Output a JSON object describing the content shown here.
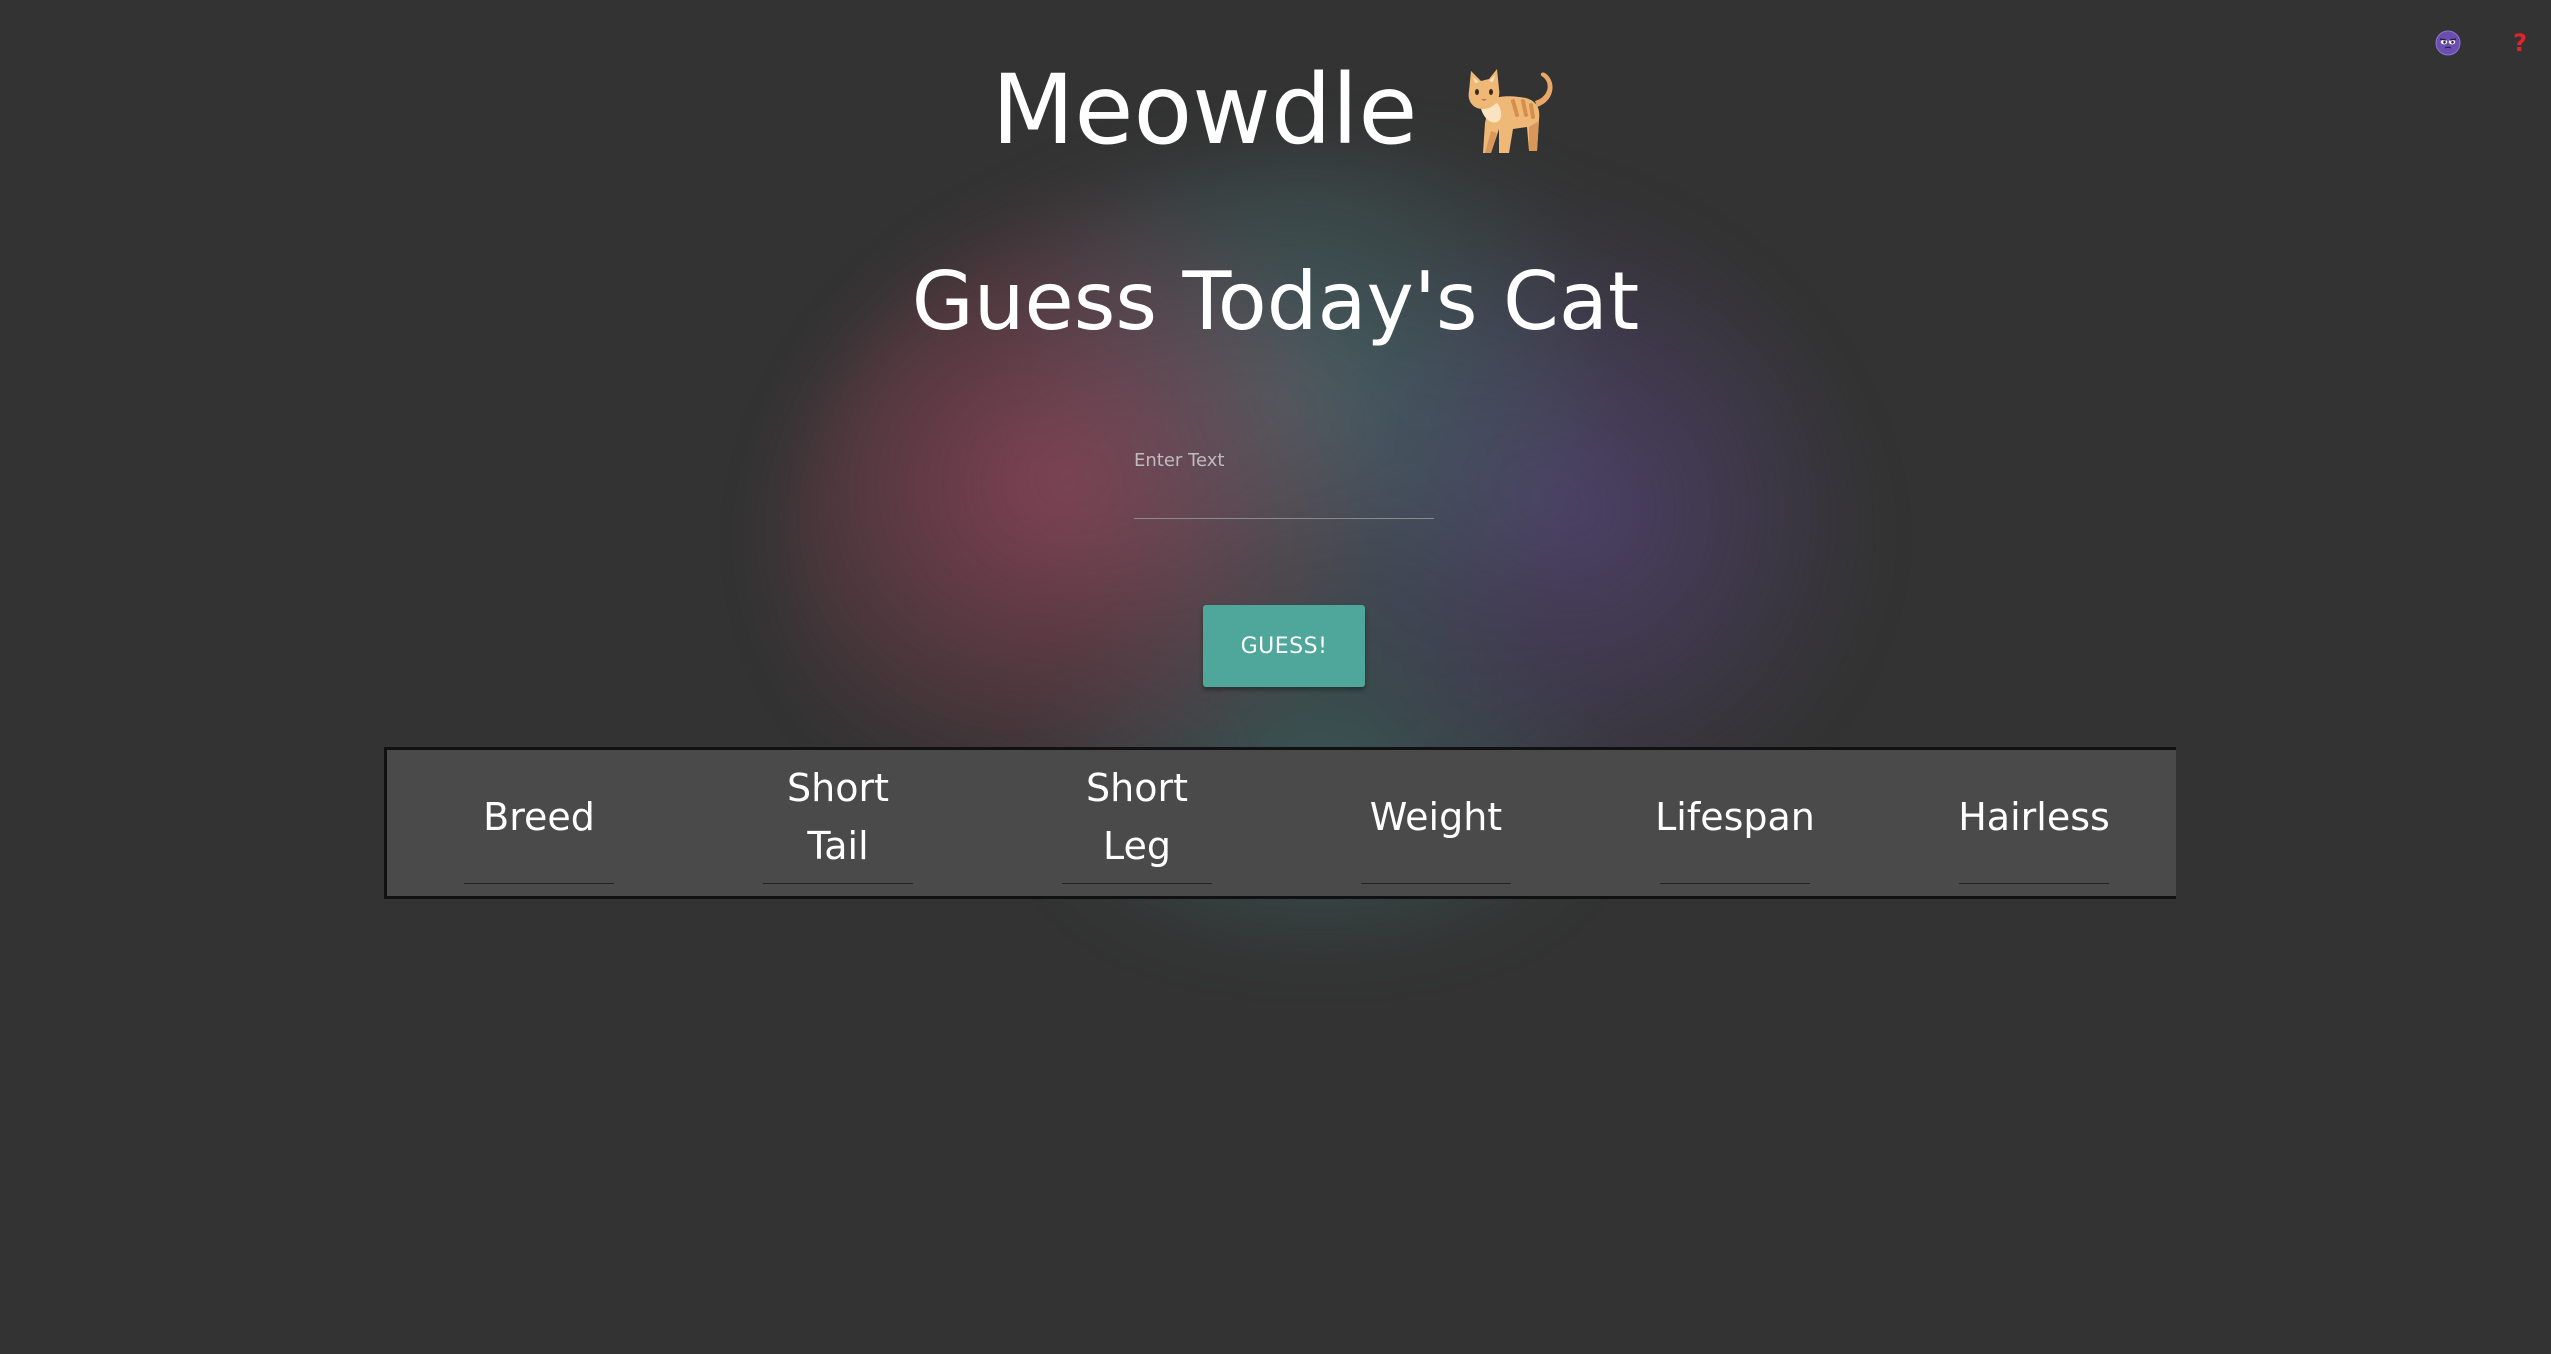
{
  "app": {
    "title": "Meowdle",
    "logo_icon": "cat-icon",
    "subtitle": "Guess Today's Cat"
  },
  "corner": {
    "theme_icon": "theme-toggle-icon",
    "help_icon": "help-icon",
    "help_glyph": "?",
    "help_color": "#e0242e"
  },
  "guess_form": {
    "label": "Enter Text",
    "value": "",
    "button_label": "GUESS!"
  },
  "attributes": [
    {
      "label": "Breed"
    },
    {
      "label": "Short Tail"
    },
    {
      "label": "Short Leg"
    },
    {
      "label": "Weight"
    },
    {
      "label": "Lifespan"
    },
    {
      "label": "Hairless"
    }
  ],
  "colors": {
    "background": "#333333",
    "accent": "#4fa79b",
    "panel": "#4a4a4a"
  }
}
